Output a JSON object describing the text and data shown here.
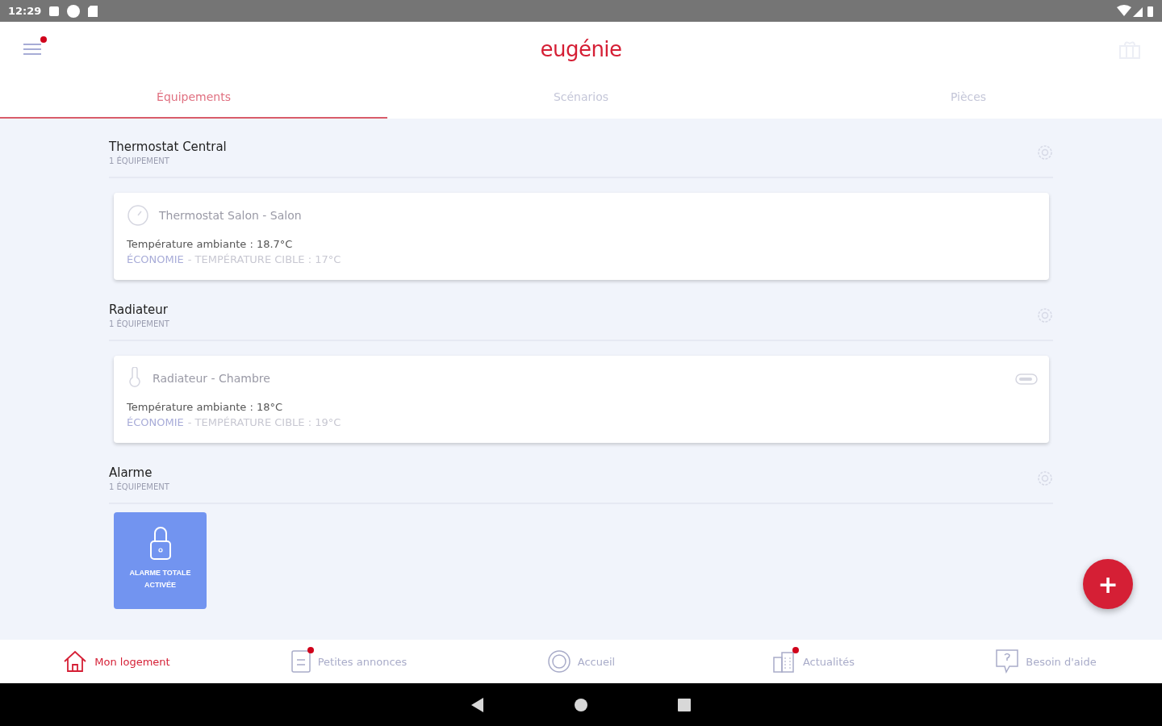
{
  "status_bar": {
    "time": "12:29"
  },
  "header": {
    "menu_badge": true,
    "logo": "eugénie"
  },
  "tabs": [
    {
      "label": "Équipements",
      "selected": true
    },
    {
      "label": "Scénarios",
      "selected": false
    },
    {
      "label": "Pièces",
      "selected": false
    }
  ],
  "sections": [
    {
      "title": "Thermostat Central",
      "count": "1 ÉQUIPEMENT",
      "devices": [
        {
          "kind": "thermostat",
          "name": "Thermostat Salon - Salon",
          "ambient": "Température ambiante : 18.7°C",
          "mode": "ÉCONOMIE",
          "target": "- TEMPÉRATURE CIBLE : 17°C",
          "indicator": false
        }
      ]
    },
    {
      "title": "Radiateur",
      "count": "1 ÉQUIPEMENT",
      "devices": [
        {
          "kind": "radiator",
          "name": "Radiateur - Chambre",
          "ambient": "Température ambiante : 18°C",
          "mode": "ÉCONOMIE",
          "target": "- TEMPÉRATURE CIBLE : 19°C",
          "indicator": true
        }
      ]
    },
    {
      "title": "Alarme",
      "count": "1 ÉQUIPEMENT",
      "devices": [
        {
          "kind": "alarm",
          "label": "ALARME TOTALE ACTIVÉE"
        }
      ]
    }
  ],
  "fab": {
    "label": "+"
  },
  "bottom_nav": [
    {
      "label": "Mon logement",
      "kind": "home",
      "selected": true,
      "badge": false
    },
    {
      "label": "Petites annonces",
      "kind": "note",
      "selected": false,
      "badge": true
    },
    {
      "label": "Accueil",
      "kind": "circle",
      "selected": false,
      "badge": false
    },
    {
      "label": "Actualités",
      "kind": "building",
      "selected": false,
      "badge": true
    },
    {
      "label": "Besoin d'aide",
      "kind": "help",
      "selected": false,
      "badge": false
    }
  ]
}
